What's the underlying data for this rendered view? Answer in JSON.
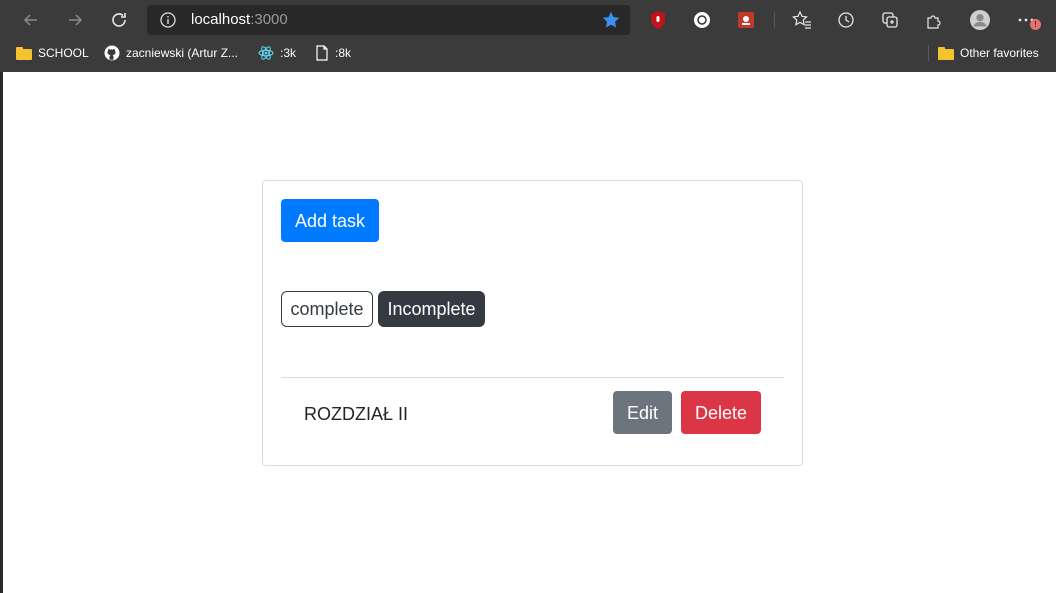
{
  "browser": {
    "url_host": "localhost",
    "url_port": ":3000",
    "bookmarks": [
      {
        "label": "SCHOOL",
        "icon": "folder-icon"
      },
      {
        "label": "zacniewski (Artur Z...",
        "icon": "github-icon"
      },
      {
        "label": ":3k",
        "icon": "react-icon"
      },
      {
        "label": ":8k",
        "icon": "page-icon"
      }
    ],
    "other_favorites": "Other favorites",
    "notification_badge": "!"
  },
  "app": {
    "add_task_label": "Add task",
    "filters": {
      "complete_label": "complete",
      "incomplete_label": "Incomplete",
      "active": "Incomplete"
    },
    "tasks": [
      {
        "title": "ROZDZIAŁ II",
        "edit_label": "Edit",
        "delete_label": "Delete"
      }
    ]
  },
  "colors": {
    "primary": "#007bff",
    "dark": "#343a40",
    "secondary": "#6c757d",
    "danger": "#dc3545",
    "chrome": "#3b3b3b"
  }
}
